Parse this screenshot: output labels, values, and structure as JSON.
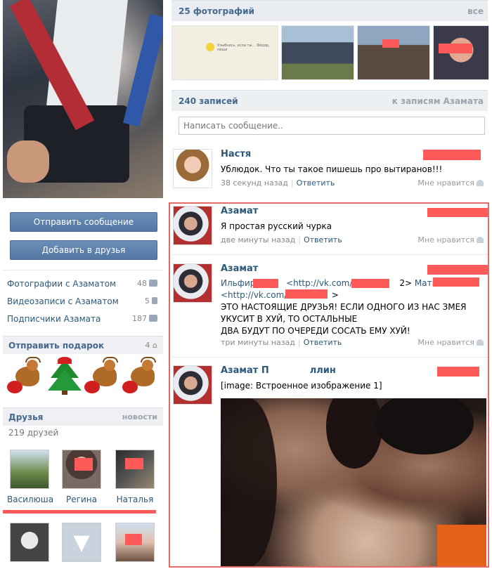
{
  "left": {
    "buttons": {
      "send_message": "Отправить сообщение",
      "add_friend": "Добавить в друзья"
    },
    "links": [
      {
        "label": "Фотографии с Азаматом",
        "count": "48",
        "icon": "camera-icon"
      },
      {
        "label": "Видеозаписи с Азаматом",
        "count": "5",
        "icon": "film-icon"
      },
      {
        "label": "Подписчики Азамата",
        "count": "187",
        "icon": "people-icon"
      }
    ],
    "gifts": {
      "title": "Отправить подарок",
      "count": "4",
      "icon": "gift-icon",
      "items": [
        "reindeer",
        "christmas-tree",
        "reindeer",
        "reindeer"
      ]
    },
    "friends": {
      "title": "Друзья",
      "news_link": "новости",
      "count_text": "219 друзей",
      "items": [
        {
          "name": "Василюша"
        },
        {
          "name": "Регина"
        },
        {
          "name": "Наталья"
        }
      ]
    }
  },
  "right": {
    "photos": {
      "title": "25 фотографий",
      "all_link": "все",
      "thumb_caption": "Улыбнись, если ты… Фёдор, пиши"
    },
    "wall": {
      "title": "240 записей",
      "to_posts_link": "к записям Азамата",
      "compose_placeholder": "Написать сообщение.."
    },
    "posts": [
      {
        "author": "Настя",
        "text": "Ублюдок. Что ты такое пишешь про вытиранов!!!",
        "time": "38 секунд назад",
        "reply": "Ответить",
        "like": "Мне нравится"
      },
      {
        "author": "Азамат",
        "text": "Я простая русский чурка",
        "time": "две минуты назад",
        "reply": "Ответить",
        "like": "Мне нравится"
      },
      {
        "author": "Азамат",
        "line1_prefix": "Ильфир",
        "line1_link": "<http://vk.com/id",
        "line1_link_end": "2>",
        "line1_suffix": "Матвей П",
        "line2_link": "<http://vk.com/i",
        "line2_end": ">",
        "line3": "ЭТО НАСТОЯЩИЕ ДРУЗЬЯ! ЕСЛИ ОДНОГО ИЗ НАС ЗМЕЯ",
        "line4": "УКУСИТ В ХУЙ, ТО ОСТАЛЬНЫЕ",
        "line5": "ДВА БУДУТ ПО ОЧЕРЕДИ СОСАТЬ ЕМУ ХУЙ!",
        "time": "три минуты назад",
        "reply": "Ответить",
        "like": "Мне нравится"
      },
      {
        "author": "Азамат П",
        "author_end": "ллин",
        "text": "[image: Встроенное изображение 1]"
      }
    ]
  },
  "colors": {
    "link": "#2b587a",
    "button": "#5b80ac",
    "header_bg": "#e9edf1",
    "highlight": "#e46a6a",
    "redaction": "#ff5a5a"
  }
}
